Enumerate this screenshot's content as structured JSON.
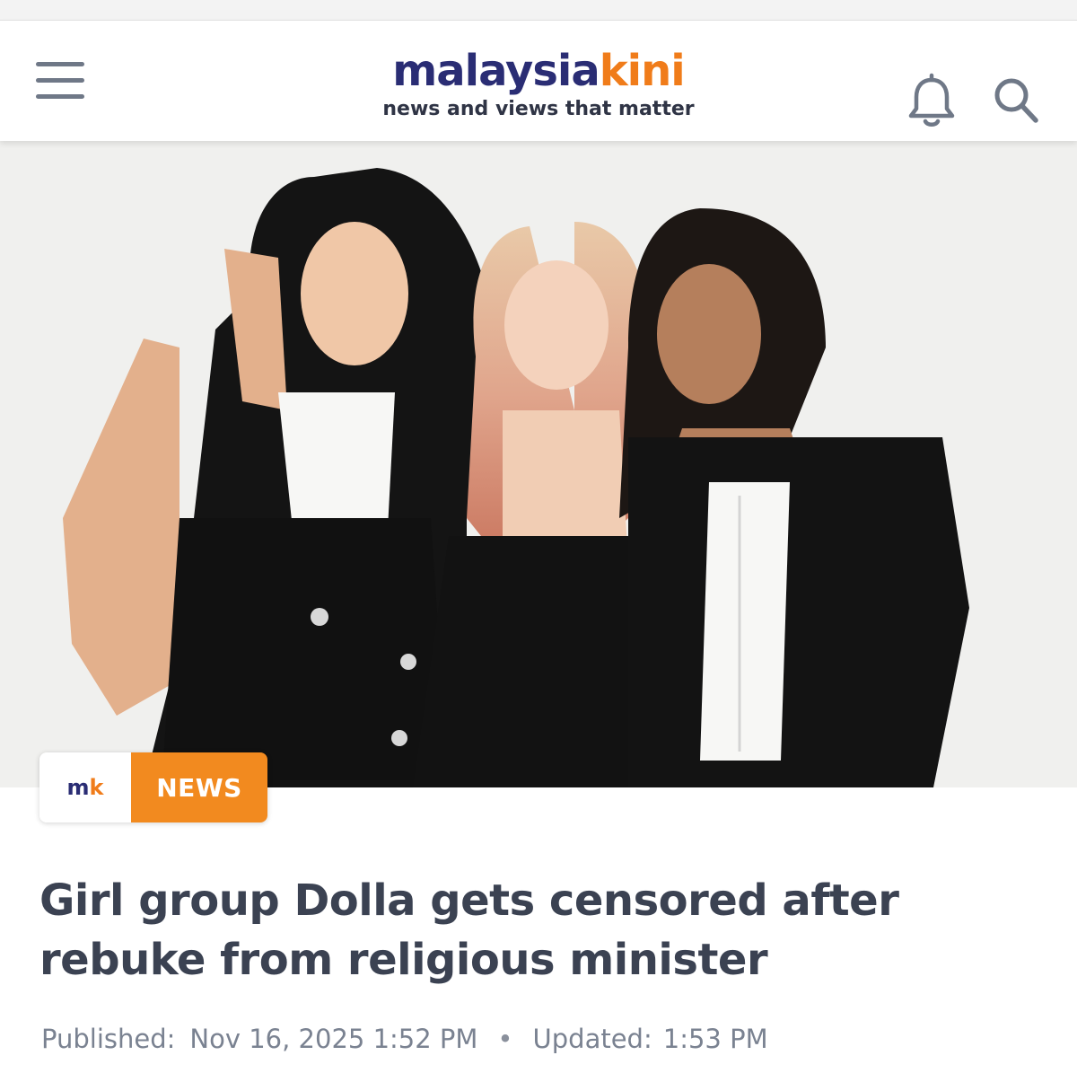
{
  "header": {
    "logo_part1": "malaysia",
    "logo_part2": "kini",
    "tagline": "news and views that matter",
    "icons": [
      "menu-icon",
      "bell-icon",
      "search-icon"
    ]
  },
  "article": {
    "badge_logo_m": "m",
    "badge_logo_k": "k",
    "category": "NEWS",
    "headline": "Girl group Dolla gets censored after rebuke from religious minister",
    "published_label": "Published:",
    "published_value": "Nov 16, 2025 1:52 PM",
    "separator": "•",
    "updated_label": "Updated:",
    "updated_value": "1:53 PM"
  },
  "colors": {
    "brand_navy": "#2a2d74",
    "brand_orange": "#f07c1a",
    "badge_orange": "#f28a1f",
    "headline_text": "#3b4252",
    "meta_text": "#7a8291"
  }
}
